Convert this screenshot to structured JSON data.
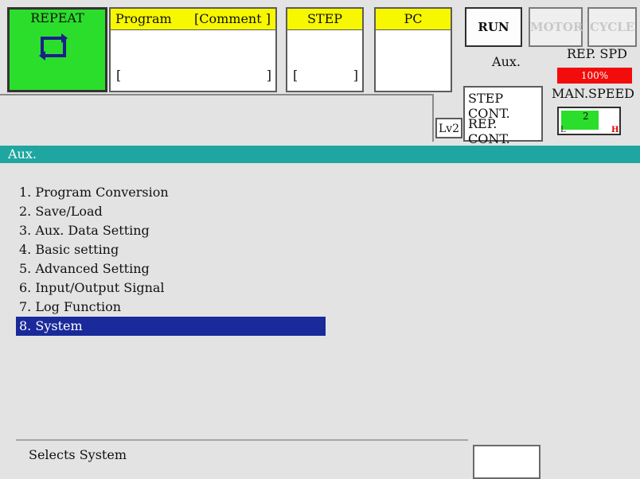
{
  "header": {
    "repeat": {
      "label": "REPEAT",
      "icon": "repeat-icon"
    },
    "program": {
      "label": "Program",
      "comment_label": "[Comment ]",
      "bracket_open": "[",
      "bracket_close": "]"
    },
    "step": {
      "label": "STEP",
      "bracket_open": "[",
      "bracket_close": "]"
    },
    "pc": {
      "label": "PC"
    },
    "buttons": {
      "run": "RUN",
      "motor": "MOTOR",
      "cycle": "CYCLE"
    },
    "aux_label": "Aux.",
    "rep_spd": {
      "label": "REP. SPD",
      "value": "100%"
    },
    "step_cont": "STEP CONT.",
    "rep_cont": "REP. CONT.",
    "man_speed": {
      "label": "MAN.SPEED",
      "level": 2,
      "min_label": "L",
      "max_label": "H"
    },
    "level": "Lv2"
  },
  "aux": {
    "title": "Aux.",
    "menu_items": [
      {
        "label": "1. Program Conversion"
      },
      {
        "label": "2. Save/Load"
      },
      {
        "label": "3. Aux. Data Setting"
      },
      {
        "label": "4. Basic setting"
      },
      {
        "label": "5. Advanced Setting"
      },
      {
        "label": "6. Input/Output Signal"
      },
      {
        "label": "7. Log Function"
      },
      {
        "label": "8. System"
      }
    ],
    "selected_index": 7
  },
  "status": {
    "text": "Selects System"
  },
  "colors": {
    "accent": "#20a6a0",
    "selected": "#1a2a9a",
    "repeat_bg": "#2bde2b",
    "rep_spd": "#f20c0c",
    "panel_title": "#f7f700"
  }
}
